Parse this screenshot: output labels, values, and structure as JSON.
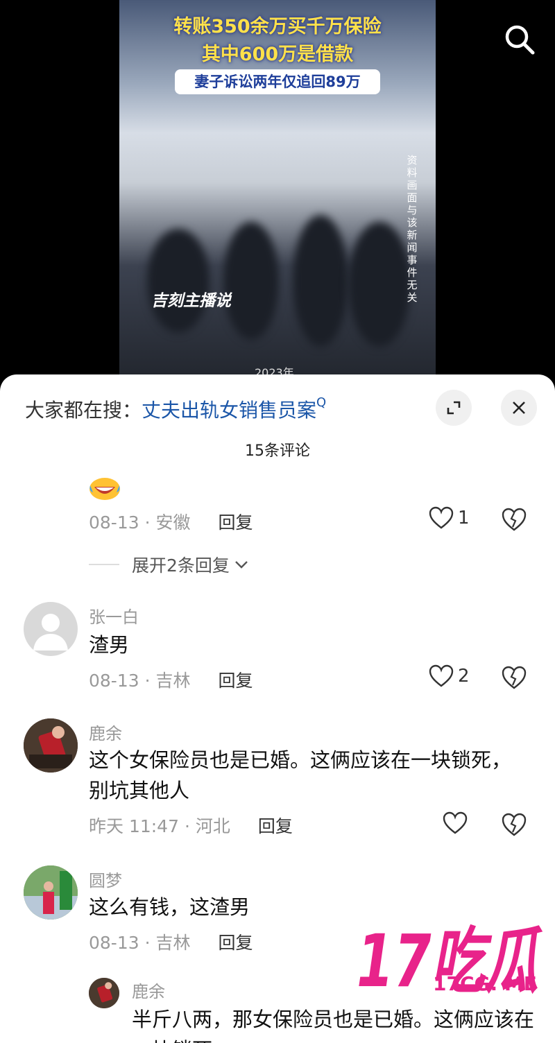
{
  "video": {
    "caption_line1": "转账350余万买千万保险",
    "caption_line2": "其中600万是借款",
    "caption_line3": "妻子诉讼两年仅追回89万",
    "side_note": "资料画面与该新闻事件无关",
    "watermark": "吉刻主播说",
    "year": "2023年"
  },
  "hot_search": {
    "prefix": "大家都在搜：",
    "keyword": "丈夫出轨女销售员案",
    "q_icon": "Q"
  },
  "comment_count": "15条评论",
  "first_comment": {
    "emoji": "laugh-cry-emoji",
    "date": "08-13",
    "sep": "·",
    "location": "安徽",
    "reply": "回复",
    "likes": "1"
  },
  "expand_replies": "展开2条回复",
  "comments": [
    {
      "user": "张一白",
      "text": "渣男",
      "date": "08-13",
      "sep": "·",
      "location": "吉林",
      "reply": "回复",
      "likes": "2"
    },
    {
      "user": "鹿余",
      "text": "这个女保险员也是已婚。这俩应该在一块锁死，别坑其他人",
      "date": "昨天 11:47",
      "sep": "·",
      "location": "河北",
      "reply": "回复",
      "likes": ""
    },
    {
      "user": "圆梦",
      "text": "这么有钱，这渣男",
      "date": "08-13",
      "sep": "·",
      "location": "吉林",
      "reply": "回复",
      "likes": ""
    }
  ],
  "sub_reply": {
    "user": "鹿余",
    "text": "半斤八两，那女保险员也是已婚。这俩应该在一块锁死"
  },
  "watermark_17": {
    "big": "17吃瓜",
    "small": "17CG. ME",
    "color": "#e8238a"
  },
  "colors": {
    "accent_blue": "#1b56a8",
    "caption_yellow": "#ffe14a"
  }
}
